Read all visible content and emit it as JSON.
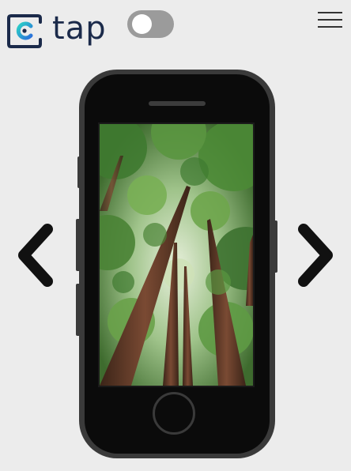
{
  "brand": {
    "name": "tap",
    "logo_mark": "c",
    "colors": {
      "navy": "#1b2a4a",
      "teal": "#25c2cf",
      "blue": "#2a6fdb"
    }
  },
  "header": {
    "toggle": {
      "state": "off"
    },
    "menu_icon": "hamburger-icon"
  },
  "nav": {
    "prev_icon": "chevron-left-icon",
    "next_icon": "chevron-right-icon"
  },
  "device": {
    "type": "phone",
    "screen_content": "redwood-trees-photo"
  },
  "colors": {
    "background": "#ececec",
    "phone_frame": "#3a3a3a",
    "phone_face": "#0b0b0b",
    "toggle_track": "#9b9b9b"
  }
}
